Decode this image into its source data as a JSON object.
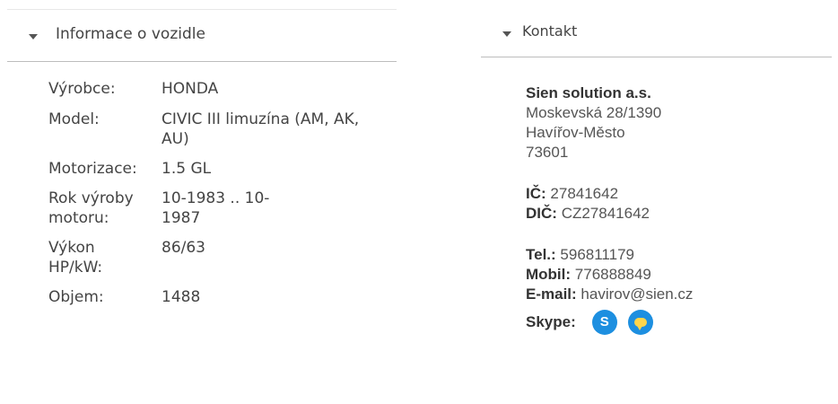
{
  "vehicle": {
    "section_title": "Informace o vozidle",
    "rows": [
      {
        "label": "Výrobce:",
        "value": "HONDA"
      },
      {
        "label": "Model:",
        "value": "CIVIC III limuzína (AM, AK, AU)"
      },
      {
        "label": "Motorizace:",
        "value": "1.5 GL"
      },
      {
        "label": "Rok výroby motoru:",
        "value": "10-1983 .. 10-1987"
      },
      {
        "label": "Výkon HP/kW:",
        "value": "86/63"
      },
      {
        "label": "Objem:",
        "value": "1488"
      }
    ]
  },
  "contact": {
    "section_title": "Kontakt",
    "company": "Sien solution a.s.",
    "street": "Moskevská 28/1390",
    "city": "Havířov-Město",
    "zip": "73601",
    "ic_label": "IČ:",
    "ic_value": "27841642",
    "dic_label": "DIČ:",
    "dic_value": "CZ27841642",
    "tel_label": "Tel.:",
    "tel_value": "596811179",
    "mobil_label": "Mobil:",
    "mobil_value": "776888849",
    "email_label": "E-mail:",
    "email_value": "havirov@sien.cz",
    "skype_label": "Skype:",
    "icons": [
      "skype-call-icon",
      "skype-chat-icon"
    ],
    "accent_color": "#1d8fe0"
  }
}
